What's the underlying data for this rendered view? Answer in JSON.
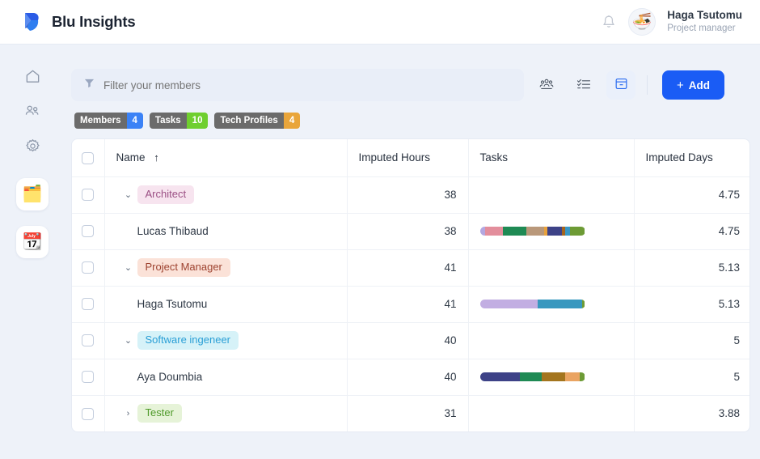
{
  "header": {
    "brand": "Blu Insights",
    "logo_icon": "blu-logo-icon",
    "bell_icon": "notification-bell-icon",
    "avatar_glyph": "🍜",
    "user_name": "Haga Tsutomu",
    "user_role": "Project manager"
  },
  "sidebar": {
    "items": [
      {
        "icon": "home-icon",
        "name": "home"
      },
      {
        "icon": "users-icon",
        "name": "members"
      },
      {
        "icon": "gear-icon",
        "name": "settings"
      }
    ],
    "cards": [
      {
        "glyph": "🗂️",
        "name": "projects-card"
      },
      {
        "glyph": "📆",
        "name": "calendar-card"
      }
    ]
  },
  "toolbar": {
    "filter_placeholder": "Filter your members",
    "filter_value": "",
    "filter_icon": "funnel-icon",
    "buttons": [
      {
        "name": "team-view-button",
        "icon": "group-users-icon",
        "active": false
      },
      {
        "name": "list-view-button",
        "icon": "checklist-icon",
        "active": false
      },
      {
        "name": "board-view-button",
        "icon": "board-icon",
        "active": true
      }
    ],
    "add_label": "Add",
    "add_plus": "+"
  },
  "chips": [
    {
      "label": "Members",
      "count": "4",
      "color": "#3b82f6"
    },
    {
      "label": "Tasks",
      "count": "10",
      "color": "#6fcf2f"
    },
    {
      "label": "Tech Profiles",
      "count": "4",
      "color": "#e9a53a"
    }
  ],
  "table": {
    "columns": [
      {
        "key": "name",
        "label": "Name",
        "sort": "↑"
      },
      {
        "key": "hours",
        "label": "Imputed Hours"
      },
      {
        "key": "tasks",
        "label": "Tasks"
      },
      {
        "key": "days",
        "label": "Imputed Days"
      }
    ],
    "rows": [
      {
        "type": "group",
        "chevron": "⌄",
        "expanded": true,
        "label": "Architect",
        "tag_bg": "#f7e4ef",
        "tag_fg": "#9b4f84",
        "hours": "38",
        "days": "4.75",
        "bar": []
      },
      {
        "type": "member",
        "label": "Lucas Thibaud",
        "hours": "38",
        "days": "4.75",
        "bar": [
          {
            "color": "#b4a7e0",
            "pct": 5
          },
          {
            "color": "#e38e9c",
            "pct": 17
          },
          {
            "color": "#1f8a54",
            "pct": 22
          },
          {
            "color": "#b9987a",
            "pct": 17
          },
          {
            "color": "#e8a13c",
            "pct": 3
          },
          {
            "color": "#3d4287",
            "pct": 14
          },
          {
            "color": "#a4651e",
            "pct": 3
          },
          {
            "color": "#3897c4",
            "pct": 5
          },
          {
            "color": "#6d9b35",
            "pct": 14
          }
        ]
      },
      {
        "type": "group",
        "chevron": "⌄",
        "expanded": true,
        "label": "Project Manager",
        "tag_bg": "#fbe2d8",
        "tag_fg": "#9e4330",
        "hours": "41",
        "days": "5.13",
        "bar": []
      },
      {
        "type": "member",
        "label": "Haga Tsutomu",
        "hours": "41",
        "days": "5.13",
        "bar": [
          {
            "color": "#c2aee2",
            "pct": 55
          },
          {
            "color": "#3898bf",
            "pct": 42
          },
          {
            "color": "#6d9b35",
            "pct": 3
          }
        ]
      },
      {
        "type": "group",
        "chevron": "⌄",
        "expanded": true,
        "label": "Software ingeneer",
        "tag_bg": "#d6f2f8",
        "tag_fg": "#2a9fd6",
        "hours": "40",
        "days": "5",
        "bar": []
      },
      {
        "type": "member",
        "label": "Aya Doumbia",
        "hours": "40",
        "days": "5",
        "bar": [
          {
            "color": "#3d4287",
            "pct": 38
          },
          {
            "color": "#1f8a54",
            "pct": 21
          },
          {
            "color": "#a4751e",
            "pct": 22
          },
          {
            "color": "#eaa462",
            "pct": 14
          },
          {
            "color": "#6d9b35",
            "pct": 5
          }
        ]
      },
      {
        "type": "group",
        "chevron": "›",
        "expanded": false,
        "label": "Tester",
        "tag_bg": "#e6f3d8",
        "tag_fg": "#4f9a2a",
        "hours": "31",
        "days": "3.88",
        "bar": []
      }
    ]
  }
}
